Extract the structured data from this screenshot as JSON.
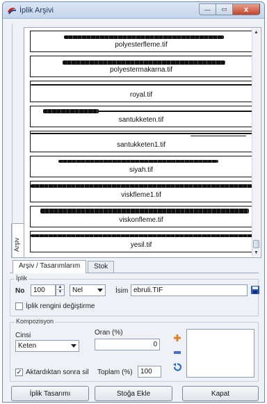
{
  "window": {
    "title": "İplik Arşivi",
    "minimize": "—",
    "maximize": "▭",
    "close": "x"
  },
  "archive": {
    "side_tab": "Arşiv",
    "items": [
      {
        "name": "polyesterfleme.tif"
      },
      {
        "name": "polyestermakarna.tif"
      },
      {
        "name": "royal.tif"
      },
      {
        "name": "santukketen.tif"
      },
      {
        "name": "santukketen1.tif"
      },
      {
        "name": "siyah.tif"
      },
      {
        "name": "viskfleme1.tif"
      },
      {
        "name": "viskonfleme.tif"
      },
      {
        "name": "yesil.tif"
      }
    ]
  },
  "tabs": [
    {
      "label": "Arşiv / Tasarımlarım"
    },
    {
      "label": "Stok"
    }
  ],
  "iplik": {
    "legend": "İplik",
    "no_label": "No",
    "no_value": "100",
    "unit_value": "Nel",
    "isim_label": "İsim",
    "isim_value": "ebruli.TIF",
    "keep_color_label": "İplik rengini değiştirme"
  },
  "kompozisyon": {
    "legend": "Kompozisyon",
    "cinsi_label": "Cinsi",
    "cinsi_value": "Keten",
    "oran_label": "Oran (%)",
    "oran_value": "0",
    "delete_after_add_label": "Aktardıktan sonra sil",
    "toplam_label": "Toplam (%)",
    "toplam_value": "100"
  },
  "buttons": {
    "design": "İplik Tasarımı",
    "add_stock": "Stoğa Ekle",
    "close": "Kapat"
  }
}
